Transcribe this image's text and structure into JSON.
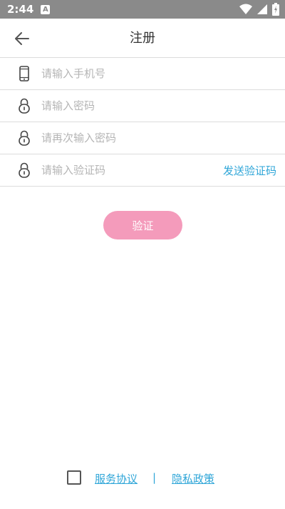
{
  "status_bar": {
    "time": "2:44",
    "notification_icon": "A",
    "icons": [
      "wifi-icon",
      "signal-icon",
      "battery-icon"
    ]
  },
  "app_bar": {
    "title": "注册",
    "back_icon": "arrow-left-icon"
  },
  "form": {
    "phone": {
      "placeholder": "请输入手机号",
      "icon": "phone-icon"
    },
    "password": {
      "placeholder": "请输入密码",
      "icon": "lock-icon"
    },
    "confirm_password": {
      "placeholder": "请再次输入密码",
      "icon": "lock-icon"
    },
    "code": {
      "placeholder": "请输入验证码",
      "icon": "lock-icon",
      "send_label": "发送验证码"
    }
  },
  "verify_button": {
    "label": "验证",
    "color": "#f49bbb"
  },
  "footer": {
    "service_agreement": "服务协议",
    "separator": "|",
    "privacy_policy": "隐私政策"
  },
  "colors": {
    "accent": "#2fa6d8",
    "button": "#f49bbb",
    "status_bar": "#8a8a8a"
  }
}
